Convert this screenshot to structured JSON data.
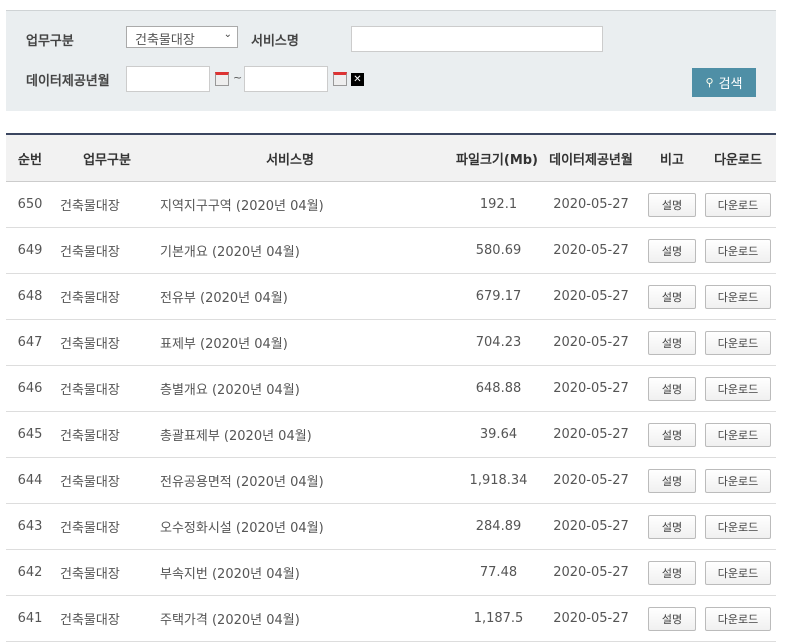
{
  "search": {
    "work_type_label": "업무구분",
    "work_type_value": "건축물대장",
    "service_name_label": "서비스명",
    "service_name_value": "",
    "date_label": "데이터제공년월",
    "date_from": "",
    "date_to": "",
    "tilde": "~",
    "clear": "✕",
    "search_button": "검색"
  },
  "table": {
    "headers": [
      "순번",
      "업무구분",
      "서비스명",
      "파일크기(Mb)",
      "데이터제공년월",
      "비고",
      "다운로드"
    ],
    "desc_button": "설명",
    "download_button": "다운로드",
    "rows": [
      [
        "650",
        "건축물대장",
        "지역지구구역 (2020년 04월)",
        "192.1",
        "2020-05-27"
      ],
      [
        "649",
        "건축물대장",
        "기본개요 (2020년 04월)",
        "580.69",
        "2020-05-27"
      ],
      [
        "648",
        "건축물대장",
        "전유부 (2020년 04월)",
        "679.17",
        "2020-05-27"
      ],
      [
        "647",
        "건축물대장",
        "표제부 (2020년 04월)",
        "704.23",
        "2020-05-27"
      ],
      [
        "646",
        "건축물대장",
        "층별개요 (2020년 04월)",
        "648.88",
        "2020-05-27"
      ],
      [
        "645",
        "건축물대장",
        "총괄표제부 (2020년 04월)",
        "39.64",
        "2020-05-27"
      ],
      [
        "644",
        "건축물대장",
        "전유공용면적 (2020년 04월)",
        "1,918.34",
        "2020-05-27"
      ],
      [
        "643",
        "건축물대장",
        "오수정화시설 (2020년 04월)",
        "284.89",
        "2020-05-27"
      ],
      [
        "642",
        "건축물대장",
        "부속지번 (2020년 04월)",
        "77.48",
        "2020-05-27"
      ],
      [
        "641",
        "건축물대장",
        "주택가격 (2020년 04월)",
        "1,187.5",
        "2020-05-27"
      ]
    ]
  }
}
